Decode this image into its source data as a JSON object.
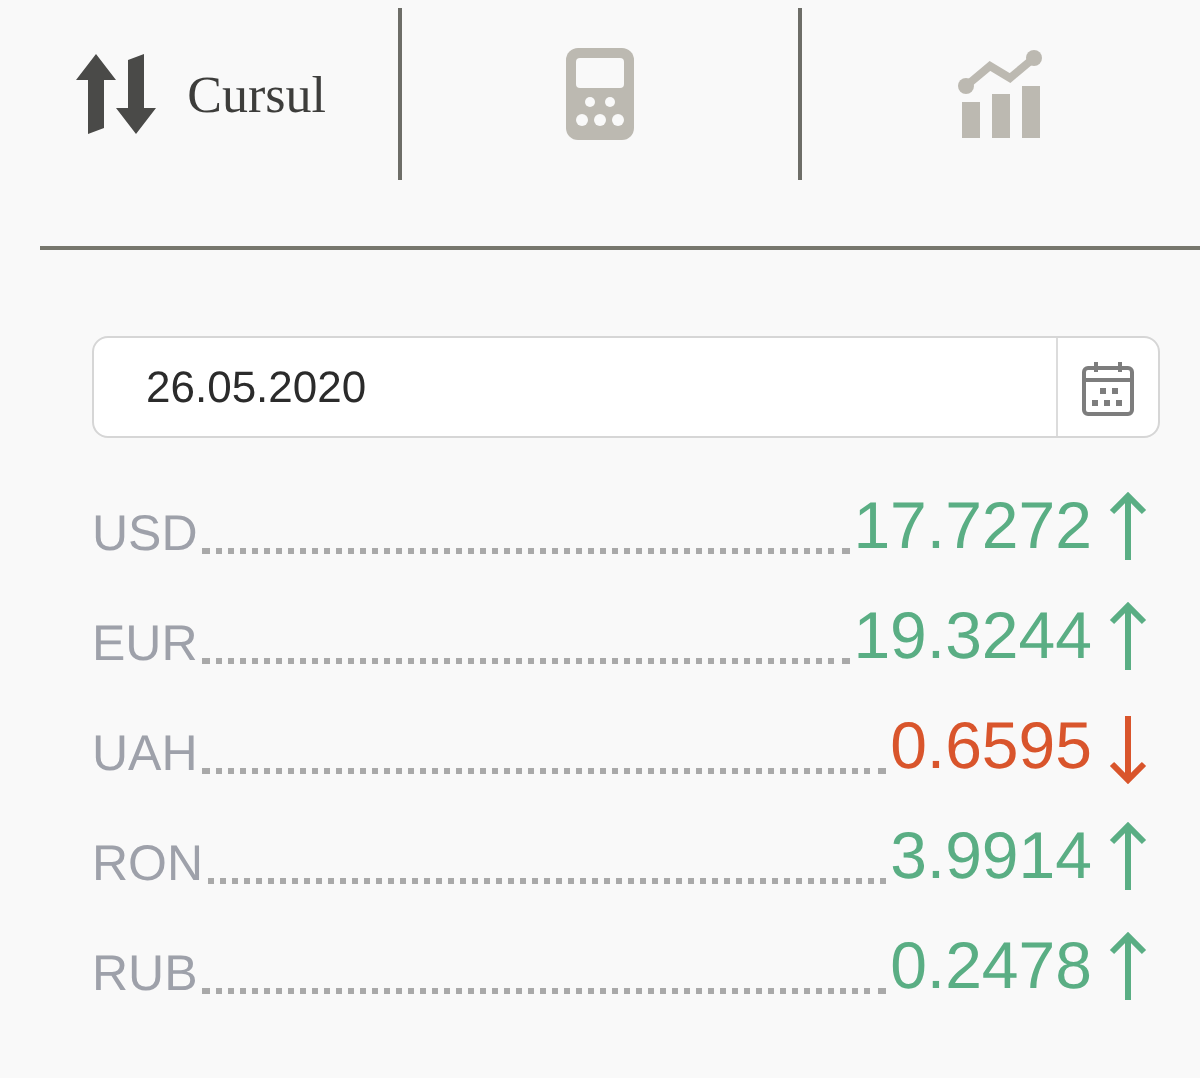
{
  "tabs": [
    {
      "kind": "exchange",
      "label": "Cursul",
      "selected": true
    },
    {
      "kind": "calculator",
      "selected": false
    },
    {
      "kind": "chart",
      "selected": false
    }
  ],
  "date_field": {
    "value": "26.05.2020"
  },
  "rates": [
    {
      "currency": "USD",
      "value": "17.7272",
      "rising": true
    },
    {
      "currency": "EUR",
      "value": "19.3244",
      "rising": true
    },
    {
      "currency": "UAH",
      "value": "0.6595",
      "rising": false
    },
    {
      "currency": "RON",
      "value": "3.9914",
      "rising": true
    },
    {
      "currency": "RUB",
      "value": "0.2478",
      "rising": true
    }
  ]
}
